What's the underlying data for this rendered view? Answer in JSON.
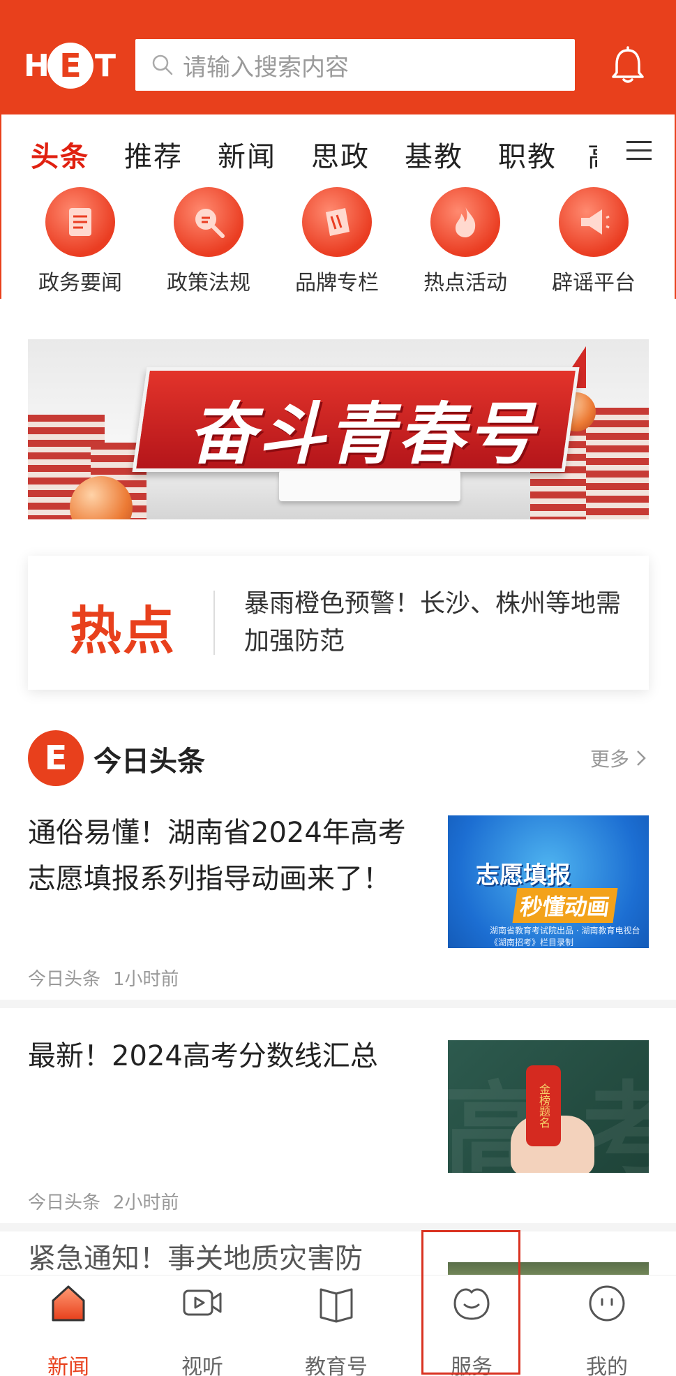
{
  "header": {
    "logo": {
      "h": "H",
      "e": "E",
      "t": "T"
    },
    "search_placeholder": "请输入搜索内容",
    "icons": [
      "search-icon",
      "bell-icon"
    ]
  },
  "tabs": [
    {
      "label": "头条",
      "active": true
    },
    {
      "label": "推荐"
    },
    {
      "label": "新闻"
    },
    {
      "label": "思政"
    },
    {
      "label": "基教"
    },
    {
      "label": "职教"
    },
    {
      "label": "高"
    }
  ],
  "quick_entries": [
    {
      "label": "政务要闻",
      "icon": "document-icon"
    },
    {
      "label": "政策法规",
      "icon": "magnifier-icon"
    },
    {
      "label": "品牌专栏",
      "icon": "brand-icon"
    },
    {
      "label": "热点活动",
      "icon": "flame-icon"
    },
    {
      "label": "辟谣平台",
      "icon": "megaphone-icon"
    }
  ],
  "banner": {
    "title": "奋斗青春号"
  },
  "hot": {
    "logo": "热点",
    "text": "暴雨橙色预警！长沙、株州等地需加强防范"
  },
  "section": {
    "logo": "E",
    "title": "今日头条",
    "more": "更多"
  },
  "news": [
    {
      "title": "通俗易懂！湖南省2024年高考志愿填报系列指导动画来了！",
      "source": "今日头条",
      "time": "1小时前",
      "thumb": {
        "line1": "志愿填报",
        "line2": "秒懂动画",
        "line3": "湖南省教育考试院出品 · 湖南教育电视台《湖南招考》栏目录制"
      }
    },
    {
      "title": "最新！2024高考分数线汇总",
      "source": "今日头条",
      "time": "2小时前",
      "thumb": {
        "bg1": "高",
        "bg2": "考",
        "tag": "金榜题名"
      }
    },
    {
      "title": "紧急通知！事关地质灾害防"
    }
  ],
  "bottom_nav": [
    {
      "label": "新闻",
      "icon": "home-icon",
      "active": true
    },
    {
      "label": "视听",
      "icon": "video-icon"
    },
    {
      "label": "教育号",
      "icon": "book-icon"
    },
    {
      "label": "服务",
      "icon": "smile-icon"
    },
    {
      "label": "我的",
      "icon": "profile-icon"
    }
  ],
  "colors": {
    "brand": "#e8401c",
    "active_tab": "#e02010",
    "muted": "#999999"
  }
}
